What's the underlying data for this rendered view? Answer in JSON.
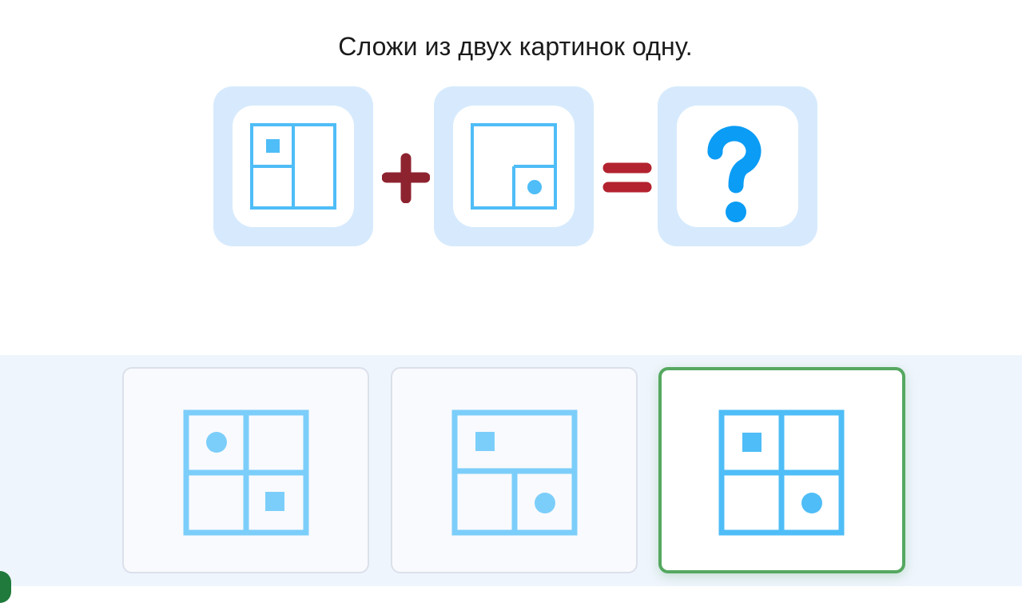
{
  "task": {
    "title": "Сложи из двух картинок одну."
  },
  "equation": {
    "operand_1": {
      "icon": "grid-square-top-left-icon"
    },
    "plus": {
      "icon": "plus-icon",
      "color": "#8e2330"
    },
    "operand_2": {
      "icon": "grid-circle-bottom-right-icon"
    },
    "equals": {
      "icon": "equals-icon",
      "color": "#b3232f"
    },
    "result": {
      "icon": "question-mark-icon",
      "glyph": "?",
      "color": "#0b9cf5"
    }
  },
  "answers": {
    "options": [
      {
        "icon": "grid-circle-top-left-square-bottom-right-icon",
        "selected": false
      },
      {
        "icon": "grid-square-top-circle-bottom-right-icon",
        "selected": false
      },
      {
        "icon": "grid-square-top-left-circle-bottom-right-icon",
        "selected": true
      }
    ]
  },
  "colors": {
    "tile_bg": "#d7eafd",
    "figure_blue": "#4fbdf7",
    "figure_blue_light": "#7ccefa",
    "selected_border": "#55a860",
    "panel_bg": "#eff5fd"
  }
}
